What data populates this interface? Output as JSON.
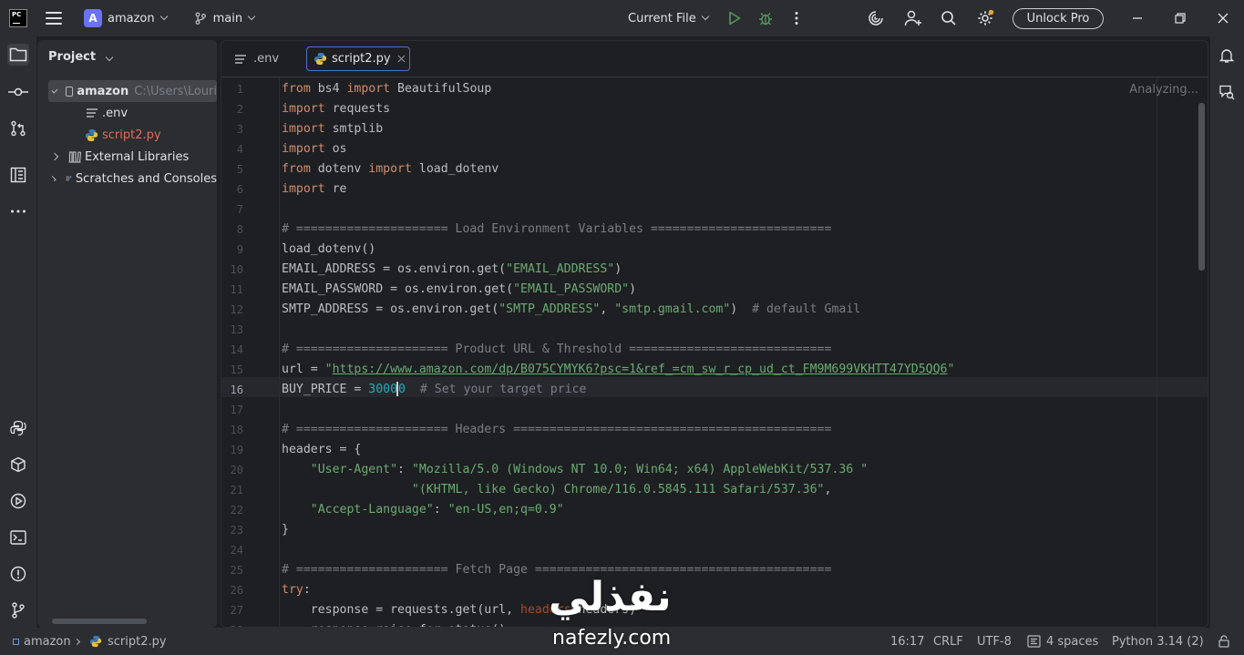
{
  "titlebar": {
    "logo_text": "PC",
    "project_initial": "A",
    "project_name": "amazon",
    "branch": "main",
    "run_config": "Current File",
    "unlock_label": "Unlock Pro"
  },
  "project_panel": {
    "title": "Project",
    "root_name": "amazon",
    "root_path": "C:\\Users\\Louri",
    "files": [
      ".env",
      "script2.py"
    ],
    "external_libraries": "External Libraries",
    "scratches": "Scratches and Consoles"
  },
  "tabs": [
    {
      "label": ".env"
    },
    {
      "label": "script2.py"
    }
  ],
  "editor": {
    "status_text": "Analyzing...",
    "current_line": 16
  },
  "code_lines": [
    "from bs4 import BeautifulSoup",
    "import requests",
    "import smtplib",
    "import os",
    "from dotenv import load_dotenv",
    "import re",
    "",
    "# ===================== Load Environment Variables =========================",
    "load_dotenv()",
    "EMAIL_ADDRESS = os.environ.get(\"EMAIL_ADDRESS\")",
    "EMAIL_PASSWORD = os.environ.get(\"EMAIL_PASSWORD\")",
    "SMTP_ADDRESS = os.environ.get(\"SMTP_ADDRESS\", \"smtp.gmail.com\")  # default Gmail",
    "",
    "# ===================== Product URL & Threshold ============================",
    "url = \"https://www.amazon.com/dp/B075CYMYK6?psc=1&ref_=cm_sw_r_cp_ud_ct_FM9M699VKHTT47YD5QQ6\"",
    "BUY_PRICE = 30000  # Set your target price",
    "",
    "# ===================== Headers ============================================",
    "headers = {",
    "    \"User-Agent\": \"Mozilla/5.0 (Windows NT 10.0; Win64; x64) AppleWebKit/537.36 \"",
    "                  \"(KHTML, like Gecko) Chrome/116.0.5845.111 Safari/537.36\",",
    "    \"Accept-Language\": \"en-US,en;q=0.9\"",
    "}",
    "",
    "# ===================== Fetch Page =========================================",
    "try:",
    "    response = requests.get(url, headers=headers)",
    "    response.raise_for_status()"
  ],
  "statusbar": {
    "breadcrumb_project": "amazon",
    "breadcrumb_file": "script2.py",
    "position": "16:17",
    "line_ending": "CRLF",
    "encoding": "UTF-8",
    "indent": "4 spaces",
    "interpreter": "Python 3.14 (2)"
  },
  "watermark": {
    "arabic": "نفذلي",
    "latin": "nafezly.com"
  },
  "colors": {
    "keyword": "#cf8e6d",
    "string": "#6aab73",
    "comment": "#7a7e85",
    "number": "#2aacb8",
    "accent": "#4a74c8"
  }
}
